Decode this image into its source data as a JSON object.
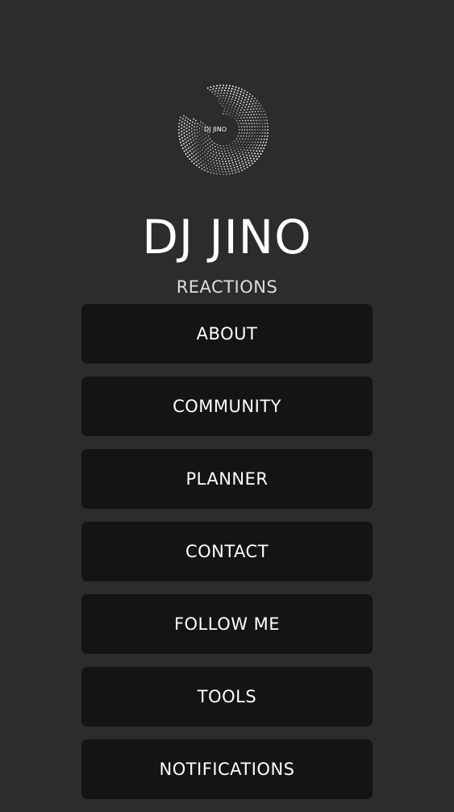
{
  "header": {
    "logo_text": "DJ JINO",
    "title": "DJ JINO",
    "subtitle": "REACTIONS"
  },
  "menu": {
    "items": [
      {
        "label": "ABOUT"
      },
      {
        "label": "COMMUNITY"
      },
      {
        "label": "PLANNER"
      },
      {
        "label": "CONTACT"
      },
      {
        "label": "FOLLOW ME"
      },
      {
        "label": "TOOLS"
      },
      {
        "label": "NOTIFICATIONS"
      }
    ]
  },
  "colors": {
    "background": "#2c2b2d",
    "button_background": "#141315",
    "text": "#ffffff"
  }
}
